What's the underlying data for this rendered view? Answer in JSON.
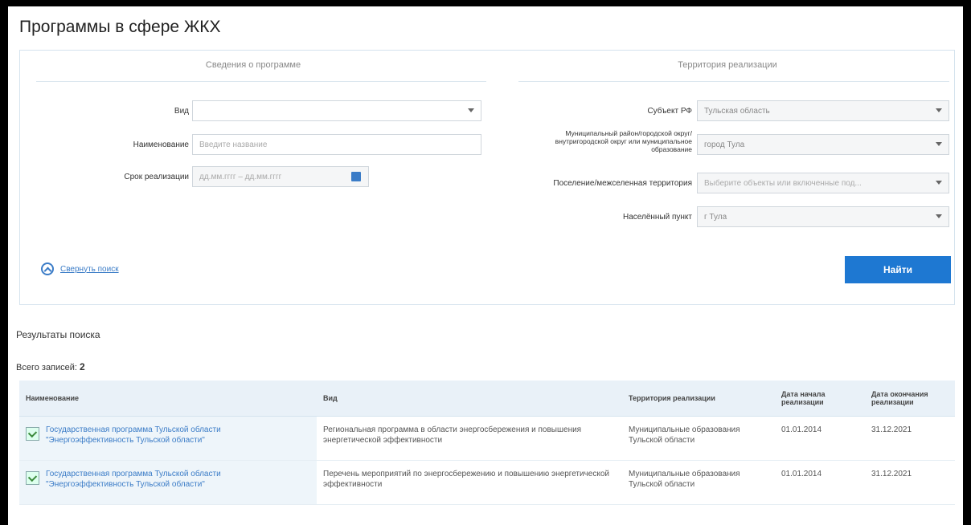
{
  "page": {
    "title": "Программы в сфере ЖКХ"
  },
  "left_section": {
    "header": "Сведения о программе",
    "vid_label": "Вид",
    "vid_value": "",
    "name_label": "Наименование",
    "name_placeholder": "Введите название",
    "period_label": "Срок реализации",
    "period_value": "дд.мм.гггг – дд.мм.гггг"
  },
  "right_section": {
    "header": "Территория реализации",
    "subject_label": "Субъект РФ",
    "subject_value": "Тульская область",
    "municipal_label": "Муниципальный район/городской округ/внутригородской округ или муниципальное образование",
    "municipal_value": "город Тула",
    "settlement_label": "Поселение/межселенная территория",
    "settlement_placeholder": "Выберите объекты или включенные под...",
    "locality_label": "Населённый пункт",
    "locality_value": "г Тула"
  },
  "actions": {
    "collapse_label": "Свернуть поиск",
    "find_label": "Найти"
  },
  "results": {
    "title": "Результаты поиска",
    "total_label": "Всего записей:",
    "total_value": "2",
    "columns": [
      "Наименование",
      "Вид",
      "Территория реализации",
      "Дата начала реализации",
      "Дата окончания реализации"
    ],
    "rows": [
      {
        "name": "Государственная программа Тульской области \"Энергоэффективность Тульской области\"",
        "vid": "Региональная программа в области энергосбережения и повышения энергетической эффективности",
        "territory": "Муниципальные образования Тульской области",
        "start": "01.01.2014",
        "end": "31.12.2021"
      },
      {
        "name": "Государственная программа Тульской области \"Энергоэффективность Тульской области\"",
        "vid": "Перечень мероприятий по энергосбережению и повышению энергетической эффективности",
        "territory": "Муниципальные образования Тульской области",
        "start": "01.01.2014",
        "end": "31.12.2021"
      }
    ]
  },
  "colors": {
    "accent": "#1e78d2",
    "link": "#3b7cc7",
    "header_bg": "#e9f1f8"
  }
}
